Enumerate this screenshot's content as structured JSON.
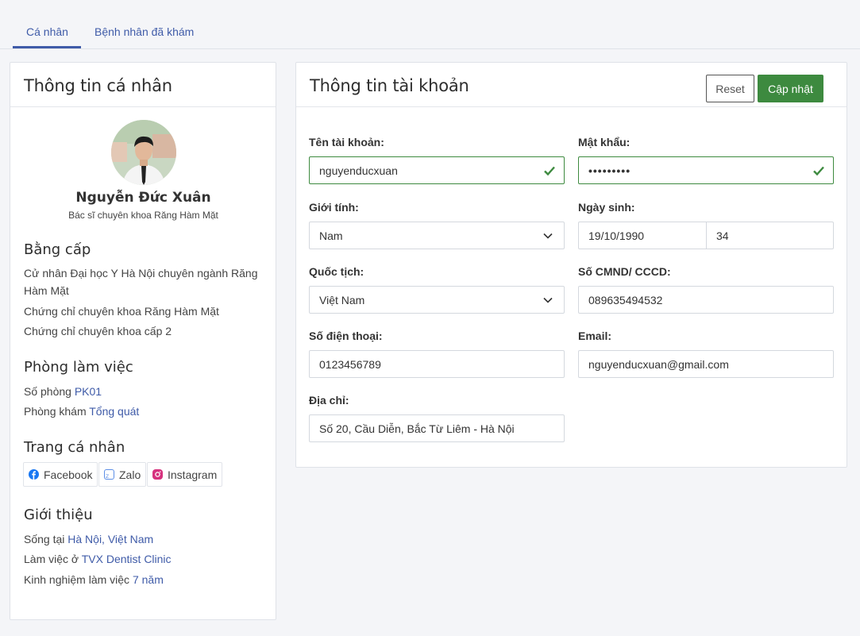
{
  "tabs": [
    {
      "label": "Cá nhân",
      "active": true
    },
    {
      "label": "Bệnh nhân đã khám",
      "active": false
    }
  ],
  "profile_card": {
    "title": "Thông tin cá nhân",
    "name": "Nguyễn Đức Xuân",
    "role": "Bác sĩ chuyên khoa Răng Hàm Mặt",
    "degrees": {
      "title": "Bằng cấp",
      "items": [
        "Cử nhân Đại học Y Hà Nội chuyên ngành Răng Hàm Mặt",
        "Chứng chỉ chuyên khoa Răng Hàm Mặt",
        "Chứng chỉ chuyên khoa cấp 2"
      ]
    },
    "workplace": {
      "title": "Phòng làm việc",
      "room_label": "Số phòng",
      "room_value": "PK01",
      "clinic_label": "Phòng khám",
      "clinic_value": "Tổng quát"
    },
    "social": {
      "title": "Trang cá nhân",
      "facebook": "Facebook",
      "zalo": "Zalo",
      "instagram": "Instagram"
    },
    "intro": {
      "title": "Giới thiệu",
      "live_label": "Sống tại",
      "live_value": "Hà Nội, Việt Nam",
      "work_label": "Làm việc ở",
      "work_value": "TVX Dentist Clinic",
      "exp_label": "Kinh nghiệm làm việc",
      "exp_value": "7 năm"
    }
  },
  "account_card": {
    "title": "Thông tin tài khoản",
    "reset_label": "Reset",
    "update_label": "Cập nhật",
    "fields": {
      "username_label": "Tên tài khoản:",
      "username_value": "nguyenducxuan",
      "password_label": "Mật khẩu:",
      "password_value": "•••••••••",
      "gender_label": "Giới tính:",
      "gender_value": "Nam",
      "dob_label": "Ngày sinh:",
      "dob_value": "19/10/1990",
      "age_value": "34",
      "nationality_label": "Quốc tịch:",
      "nationality_value": "Việt Nam",
      "id_label": "Số CMND/ CCCD:",
      "id_value": "089635494532",
      "phone_label": "Số điện thoại:",
      "phone_value": "0123456789",
      "email_label": "Email:",
      "email_value": "nguyenducxuan@gmail.com",
      "address_label": "Địa chỉ:",
      "address_value": "Số 20, Cầu Diễn, Bắc Từ Liêm - Hà Nội"
    }
  },
  "colors": {
    "accent": "#3f5ba8",
    "success": "#3d8a3f",
    "page_bg": "#f4f5f8"
  }
}
